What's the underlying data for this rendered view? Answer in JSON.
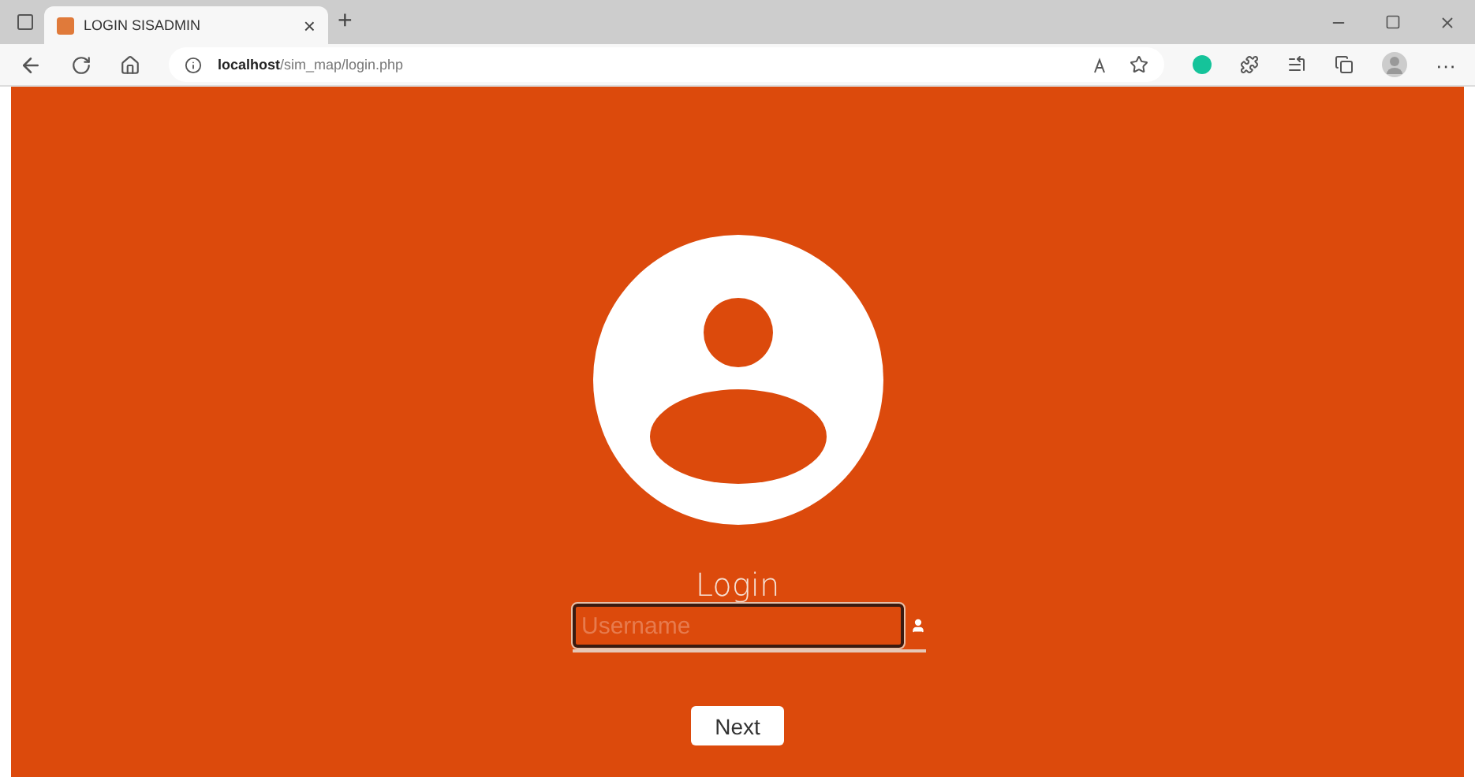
{
  "browser": {
    "tabs": [
      {
        "title": "LOGIN SISADMIN",
        "selected": true
      }
    ],
    "close_tab": "×",
    "new_tab": "+",
    "address": "**localhost**/sim_map/login.php",
    "more": "···"
  },
  "login": {
    "title": "Login",
    "username": {
      "placeholder": "Username"
    },
    "next": "Next"
  }
}
